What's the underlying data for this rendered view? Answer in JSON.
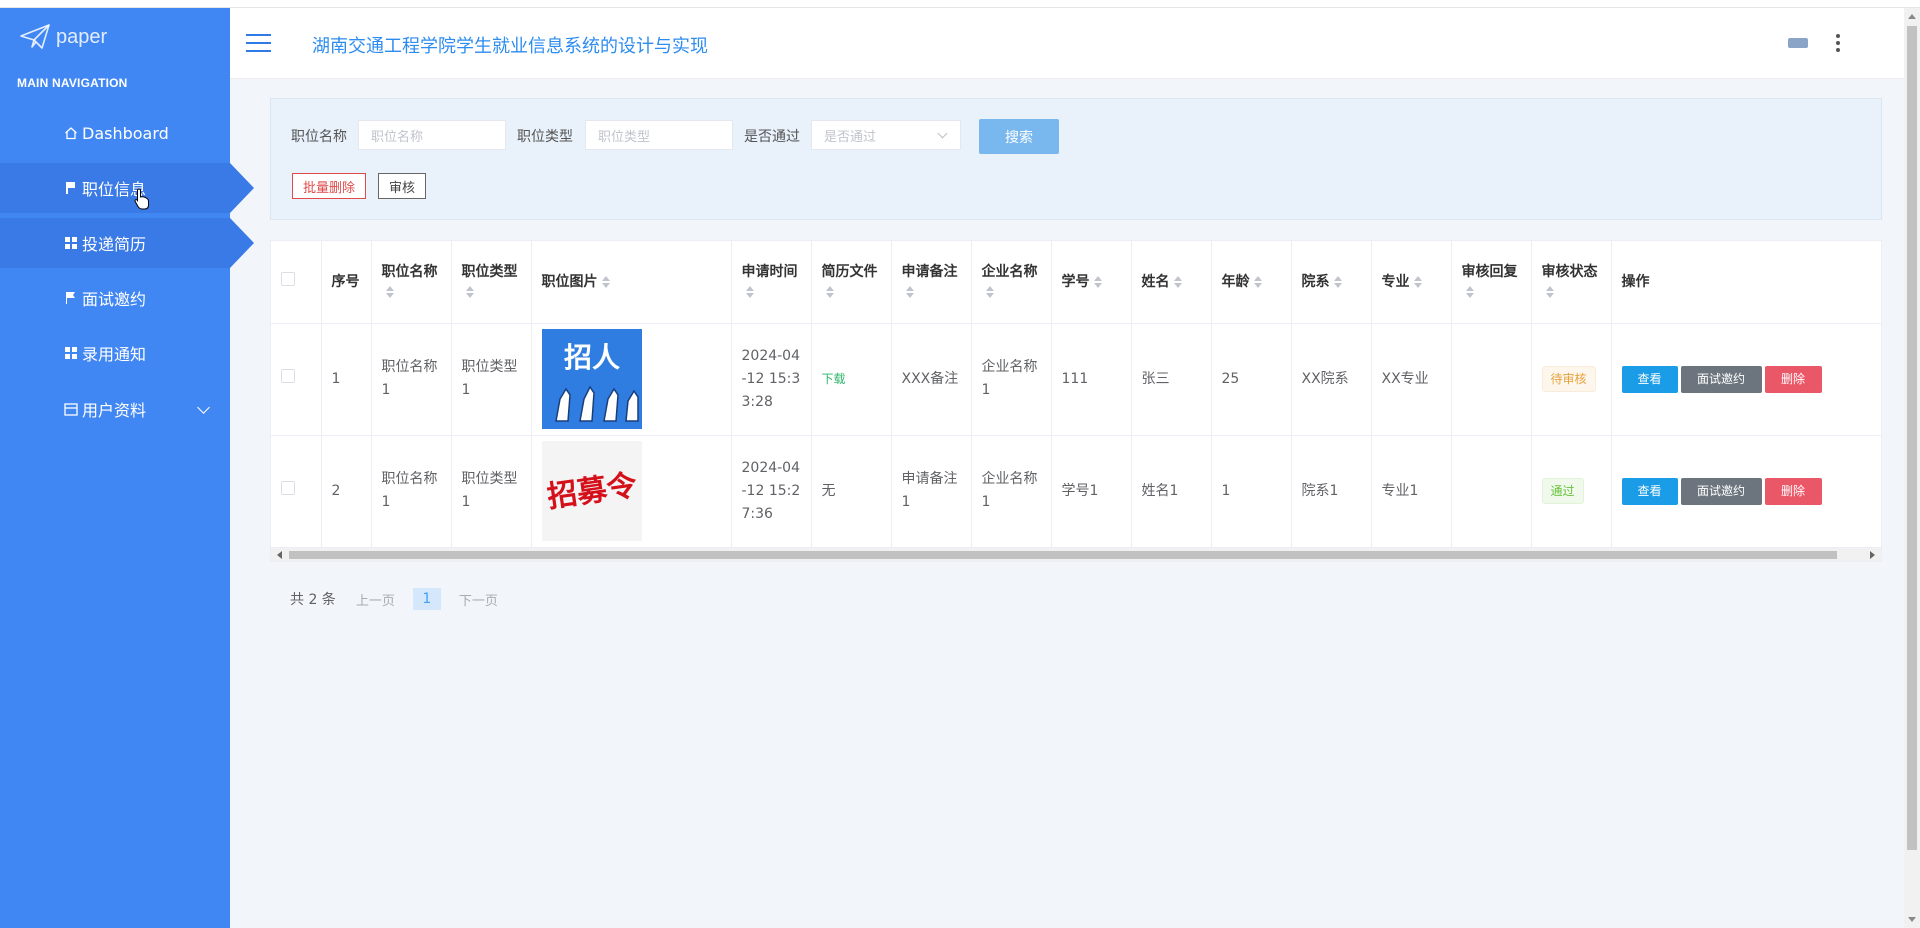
{
  "app": {
    "logo_text": "paper",
    "system_title": "湖南交通工程学院学生就业信息系统的设计与实现"
  },
  "sidebar": {
    "section_title": "MAIN NAVIGATION",
    "items": [
      {
        "label": "Dashboard",
        "icon": "home-icon"
      },
      {
        "label": "职位信息",
        "icon": "flag-icon",
        "active": true
      },
      {
        "label": "投递简历",
        "icon": "grid-icon",
        "active": true
      },
      {
        "label": "面试邀约",
        "icon": "flag-icon"
      },
      {
        "label": "录用通知",
        "icon": "grid-icon"
      },
      {
        "label": "用户资料",
        "icon": "calendar-icon",
        "has_submenu": true
      }
    ]
  },
  "search": {
    "fields": [
      {
        "label": "职位名称",
        "placeholder": "职位名称"
      },
      {
        "label": "职位类型",
        "placeholder": "职位类型"
      },
      {
        "label": "是否通过",
        "placeholder": "是否通过"
      }
    ],
    "search_button": "搜索",
    "batch_delete_button": "批量删除",
    "audit_button": "审核"
  },
  "table": {
    "headers": [
      "序号",
      "职位名称",
      "职位类型",
      "职位图片",
      "申请时间",
      "简历文件",
      "申请备注",
      "企业名称",
      "学号",
      "姓名",
      "年龄",
      "院系",
      "专业",
      "审核回复",
      "审核状态",
      "操作"
    ],
    "rows": [
      {
        "index": "1",
        "job_name": "职位名称1",
        "job_type": "职位类型1",
        "image": "招人",
        "apply_time": "2024-04-12 15:33:28",
        "resume": "下载",
        "remark": "XXX备注",
        "company": "企业名称1",
        "student_no": "111",
        "name": "张三",
        "age": "25",
        "dept": "XX院系",
        "major": "XX专业",
        "reply": "",
        "status": "待审核"
      },
      {
        "index": "2",
        "job_name": "职位名称1",
        "job_type": "职位类型1",
        "image": "招募令",
        "apply_time": "2024-04-12 15:27:36",
        "resume": "无",
        "remark": "申请备注1",
        "company": "企业名称1",
        "student_no": "学号1",
        "name": "姓名1",
        "age": "1",
        "dept": "院系1",
        "major": "专业1",
        "reply": "",
        "status": "通过"
      }
    ],
    "actions": {
      "view": "查看",
      "invite": "面试邀约",
      "delete": "删除"
    }
  },
  "pagination": {
    "total": "共 2 条",
    "prev": "上一页",
    "current": "1",
    "next": "下一页"
  },
  "colors": {
    "sidebar": "#4187f4",
    "primary": "#1a9ce6",
    "danger": "#ea5766",
    "secondary": "#6c757d"
  }
}
